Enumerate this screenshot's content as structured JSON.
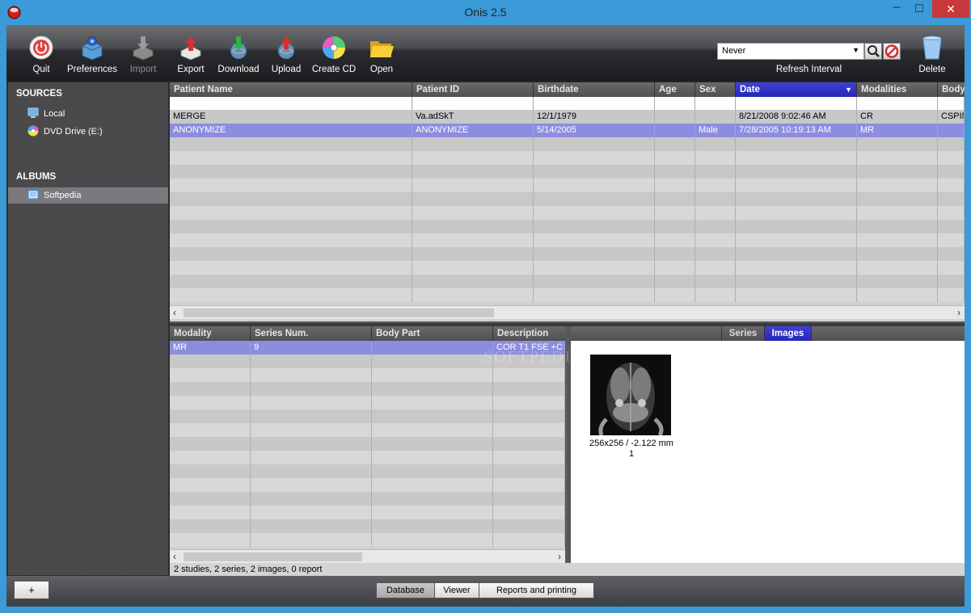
{
  "window": {
    "title": "Onis 2.5",
    "minimize": "─",
    "maximize": "☐",
    "close": "✕"
  },
  "toolbar": {
    "items": [
      {
        "label": "Quit",
        "icon": "power-icon"
      },
      {
        "label": "Preferences",
        "icon": "preferences-icon"
      },
      {
        "label": "Import",
        "icon": "import-icon",
        "disabled": true
      },
      {
        "label": "Export",
        "icon": "export-icon"
      },
      {
        "label": "Download",
        "icon": "download-icon"
      },
      {
        "label": "Upload",
        "icon": "upload-icon"
      },
      {
        "label": "Create CD",
        "icon": "cd-icon"
      },
      {
        "label": "Open",
        "icon": "folder-icon"
      }
    ],
    "refresh_value": "Never",
    "refresh_label": "Refresh Interval",
    "delete_label": "Delete"
  },
  "sidebar": {
    "sources_header": "SOURCES",
    "sources": [
      {
        "label": "Local"
      },
      {
        "label": "DVD Drive (E:)"
      }
    ],
    "albums_header": "ALBUMS",
    "albums": [
      {
        "label": "Softpedia"
      }
    ]
  },
  "studies": {
    "columns": [
      "Patient Name",
      "Patient ID",
      "Birthdate",
      "Age",
      "Sex",
      "Date",
      "Modalities",
      "Body"
    ],
    "rows": [
      [
        "MERGE",
        "Va.adSkT",
        "12/1/1979",
        "",
        "",
        "8/21/2008 9:02:46 AM",
        "CR",
        "CSPIN"
      ],
      [
        "ANONYMIZE",
        "ANONYMIZE",
        "5/14/2005",
        "",
        "Male",
        "7/28/2005 10:19:13 AM",
        "MR",
        ""
      ]
    ]
  },
  "series": {
    "columns": [
      "Modality",
      "Series Num.",
      "Body Part",
      "Description"
    ],
    "rows": [
      [
        "MR",
        "9",
        "",
        "COR T1 FSE +C"
      ]
    ]
  },
  "viewer": {
    "tabs": [
      "Series",
      "Images"
    ],
    "image_caption": "256x256 / -2.122 mm",
    "image_index": "1"
  },
  "status": "2 studies, 2 series, 2 images, 0 report",
  "bottom": {
    "plus": "+",
    "tabs": [
      "Database",
      "Viewer",
      "Reports and printing"
    ]
  },
  "colors": {
    "accent": "#2f31c8",
    "selection": "#8d8ddf",
    "titlebar": "#3a9bd8"
  }
}
